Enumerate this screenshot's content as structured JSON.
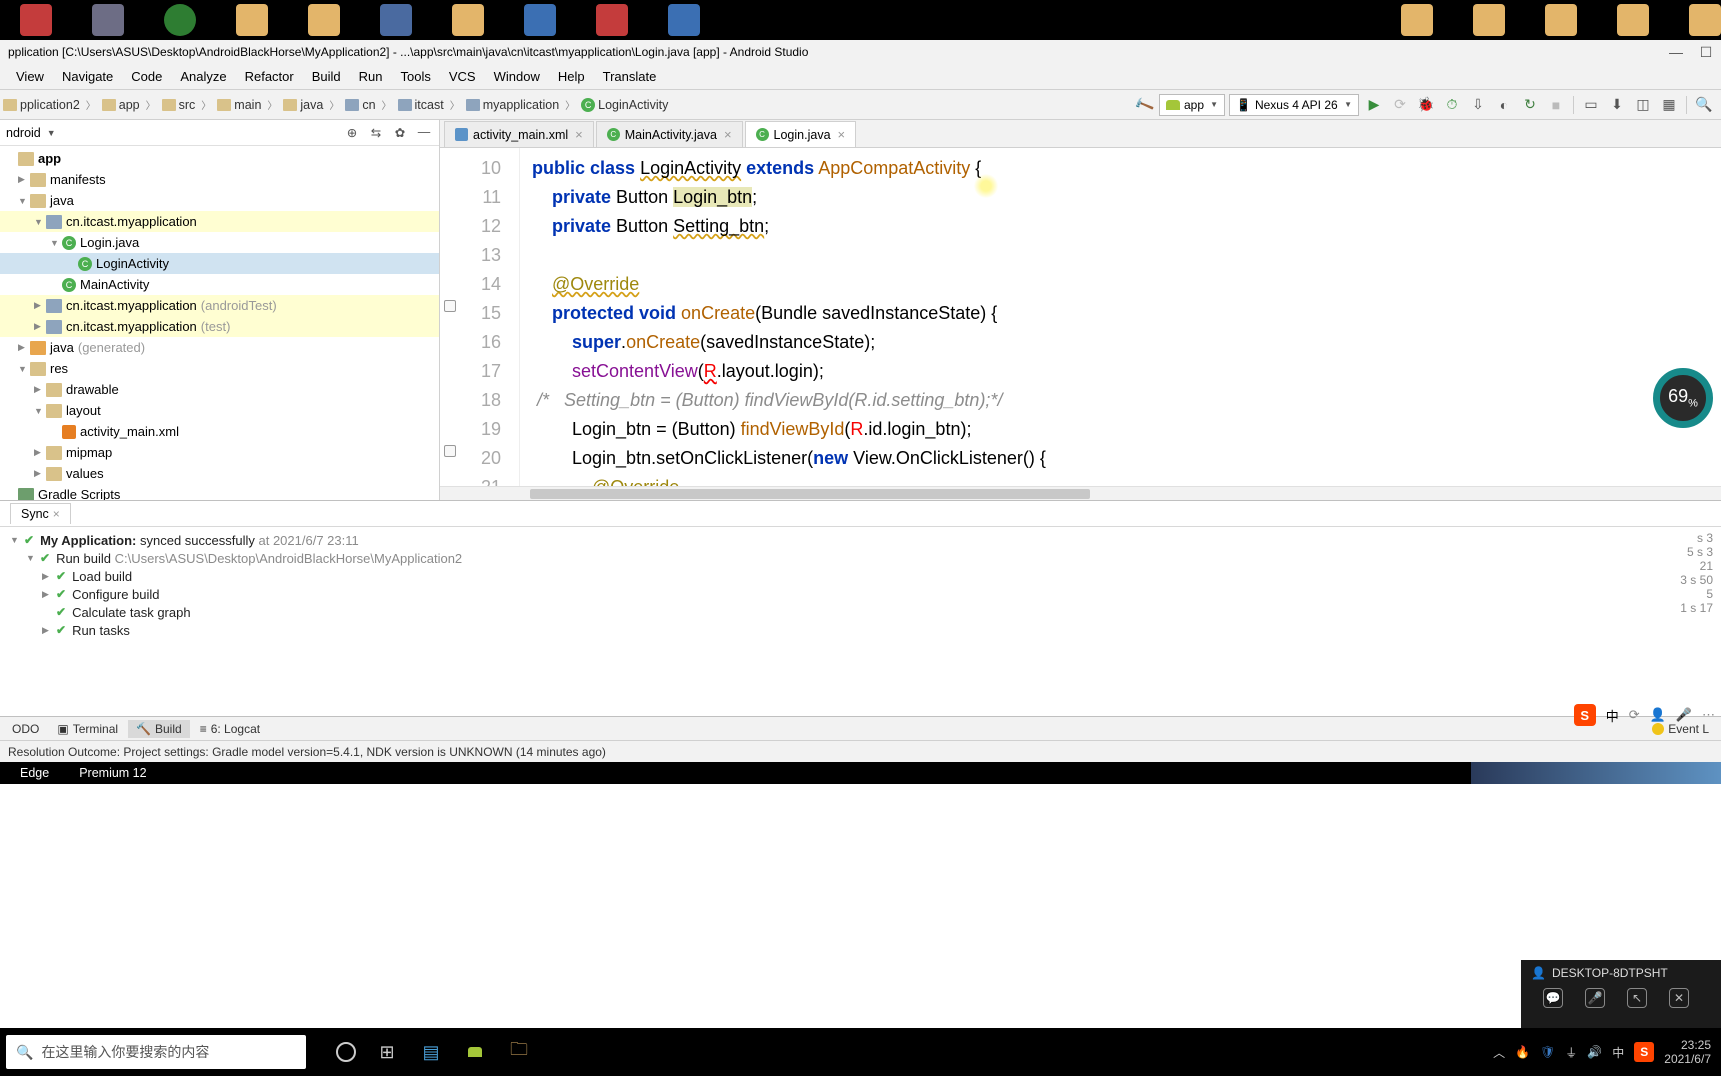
{
  "title_bar": "pplication [C:\\Users\\ASUS\\Desktop\\AndroidBlackHorse\\MyApplication2] - ...\\app\\src\\main\\java\\cn\\itcast\\myapplication\\Login.java [app] - Android Studio",
  "menu": [
    "View",
    "Navigate",
    "Code",
    "Analyze",
    "Refactor",
    "Build",
    "Run",
    "Tools",
    "VCS",
    "Window",
    "Help",
    "Translate"
  ],
  "breadcrumb": [
    "pplication2",
    "app",
    "src",
    "main",
    "java",
    "cn",
    "itcast",
    "myapplication",
    "LoginActivity"
  ],
  "run_config": {
    "app": "app",
    "device": "Nexus 4 API 26"
  },
  "tree_header": "ndroid",
  "tree": {
    "app": "app",
    "manifests": "manifests",
    "java": "java",
    "pkg_main": "cn.itcast.myapplication",
    "login_java": "Login.java",
    "login_activity": "LoginActivity",
    "main_activity": "MainActivity",
    "pkg_atest": "cn.itcast.myapplication",
    "pkg_atest_suffix": "(androidTest)",
    "pkg_test": "cn.itcast.myapplication",
    "pkg_test_suffix": "(test)",
    "java_gen": "java",
    "java_gen_suffix": "(generated)",
    "res": "res",
    "drawable": "drawable",
    "layout": "layout",
    "activity_main_xml": "activity_main.xml",
    "mipmap": "mipmap",
    "values": "values",
    "gradle_scripts": "Gradle Scripts"
  },
  "tabs": [
    {
      "label": "activity_main.xml",
      "type": "xml"
    },
    {
      "label": "MainActivity.java",
      "type": "cls"
    },
    {
      "label": "Login.java",
      "type": "cls",
      "active": true
    }
  ],
  "code_lines": {
    "start": 10,
    "lines": [
      "public class LoginActivity extends AppCompatActivity {",
      "    private Button Login_btn;",
      "    private Button Setting_btn;",
      "",
      "    @Override",
      "    protected void onCreate(Bundle savedInstanceState) {",
      "        super.onCreate(savedInstanceState);",
      "        setContentView(R.layout.login);",
      " /*   Setting_btn = (Button) findViewById(R.id.setting_btn);*/",
      "        Login_btn = (Button) findViewById(R.id.login_btn);",
      "        Login_btn.setOnClickListener(new View.OnClickListener() {",
      "            @Override"
    ]
  },
  "perf_badge": "69",
  "sync_tab": "Sync",
  "build": {
    "root": "My Application:",
    "root_status": "synced successfully",
    "root_time": "at 2021/6/7 23:11",
    "run_build": "Run build",
    "run_build_path": "C:\\Users\\ASUS\\Desktop\\AndroidBlackHorse\\MyApplication2",
    "load": "Load build",
    "configure": "Configure build",
    "graph": "Calculate task graph",
    "tasks": "Run tasks",
    "t_root": "s 3",
    "t_run": "5 s 3",
    "t_load": "21",
    "t_conf": "3 s 50",
    "t_graph": "5",
    "t_tasks": "1 s 17"
  },
  "tool_tabs": {
    "todo": "ODO",
    "terminal": "Terminal",
    "build": "Build",
    "logcat": "6: Logcat",
    "event": "Event L"
  },
  "status_msg": "Resolution Outcome: Project settings: Gradle model version=5.4.1, NDK version is UNKNOWN (14 minutes ago)",
  "status_right": "中",
  "edge_strip": {
    "a": "Edge",
    "b": "Premium 12"
  },
  "rd_popup": {
    "host": "DESKTOP-8DTPSHT"
  },
  "win_search_placeholder": "在这里输入你要搜索的内容",
  "clock": {
    "time": "23:25",
    "date": "2021/6/7"
  },
  "ime": "中"
}
